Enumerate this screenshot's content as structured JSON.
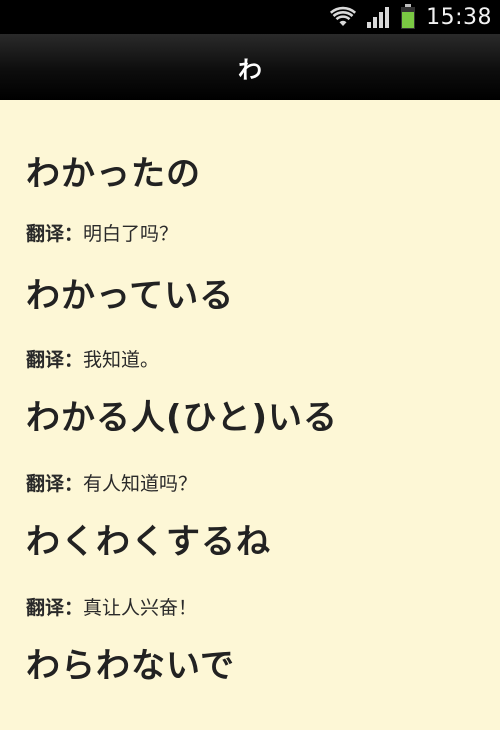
{
  "status_bar": {
    "time": "15:38",
    "icons": [
      "wifi-icon",
      "signal-icon",
      "battery-icon"
    ],
    "battery_color": "#7ac943"
  },
  "action_bar": {
    "title": "わ"
  },
  "entries": [
    {
      "phrase": "わかったの",
      "label": "翻译：",
      "translation": "明白了吗？"
    },
    {
      "phrase": "わかっている",
      "label": "翻译：",
      "translation": "我知道。"
    },
    {
      "phrase": "わかる人(ひと)いる",
      "label": "翻译：",
      "translation": "有人知道吗？"
    },
    {
      "phrase": "わくわくするね",
      "label": "翻译：",
      "translation": "真让人兴奋！"
    },
    {
      "phrase": "わらわないで",
      "label": "",
      "translation": ""
    }
  ],
  "colors": {
    "background": "#fdf7d6",
    "status_bar": "#000000",
    "action_bar": "#111111",
    "text": "#222222"
  }
}
